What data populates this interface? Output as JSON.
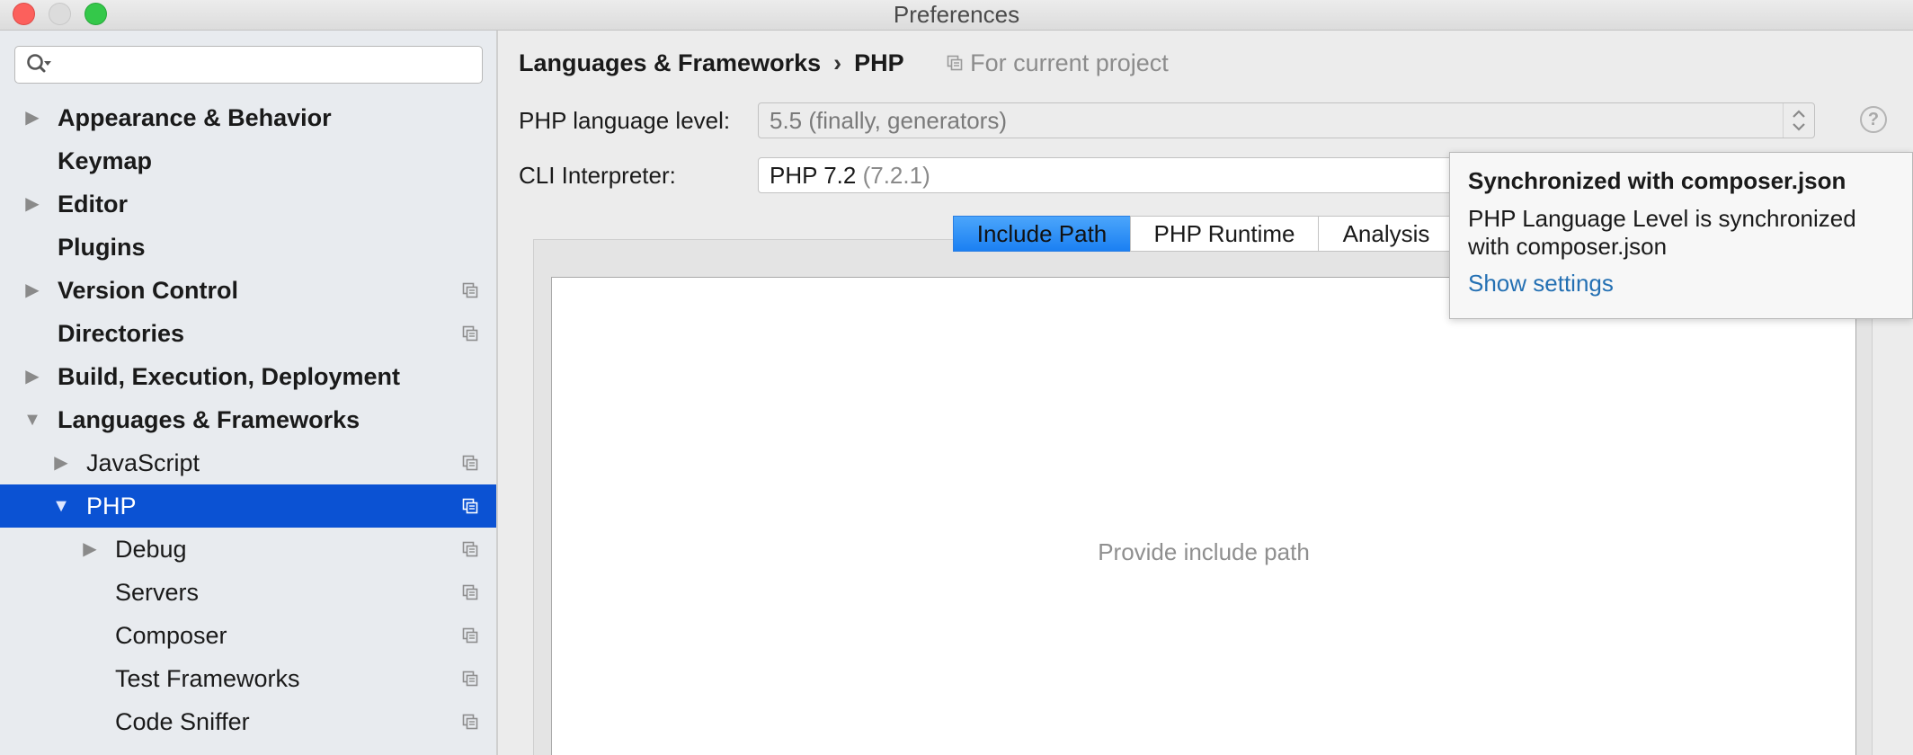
{
  "window": {
    "title": "Preferences"
  },
  "search": {
    "value": "",
    "placeholder": ""
  },
  "sidebar": {
    "items": [
      {
        "label": "Appearance & Behavior",
        "bold": true,
        "arrow": "right",
        "level": 0,
        "project_icon": false
      },
      {
        "label": "Keymap",
        "bold": true,
        "arrow": "none",
        "level": 0,
        "project_icon": false
      },
      {
        "label": "Editor",
        "bold": true,
        "arrow": "right",
        "level": 0,
        "project_icon": false
      },
      {
        "label": "Plugins",
        "bold": true,
        "arrow": "none",
        "level": 0,
        "project_icon": false
      },
      {
        "label": "Version Control",
        "bold": true,
        "arrow": "right",
        "level": 0,
        "project_icon": true
      },
      {
        "label": "Directories",
        "bold": true,
        "arrow": "none",
        "level": 0,
        "project_icon": true
      },
      {
        "label": "Build, Execution, Deployment",
        "bold": true,
        "arrow": "right",
        "level": 0,
        "project_icon": false
      },
      {
        "label": "Languages & Frameworks",
        "bold": true,
        "arrow": "down",
        "level": 0,
        "project_icon": false
      },
      {
        "label": "JavaScript",
        "bold": false,
        "arrow": "right",
        "level": 1,
        "project_icon": true
      },
      {
        "label": "PHP",
        "bold": false,
        "arrow": "down",
        "level": 1,
        "project_icon": true,
        "selected": true
      },
      {
        "label": "Debug",
        "bold": false,
        "arrow": "right",
        "level": 2,
        "project_icon": true
      },
      {
        "label": "Servers",
        "bold": false,
        "arrow": "none",
        "level": 2,
        "project_icon": true
      },
      {
        "label": "Composer",
        "bold": false,
        "arrow": "none",
        "level": 2,
        "project_icon": true
      },
      {
        "label": "Test Frameworks",
        "bold": false,
        "arrow": "none",
        "level": 2,
        "project_icon": true
      },
      {
        "label": "Code Sniffer",
        "bold": false,
        "arrow": "none",
        "level": 2,
        "project_icon": true
      }
    ]
  },
  "breadcrumb": {
    "parent": "Languages & Frameworks",
    "separator": "›",
    "current": "PHP",
    "scope_note": "For current project"
  },
  "form": {
    "language_level_label": "PHP language level:",
    "language_level_value": "5.5 (finally, generators)",
    "cli_label": "CLI Interpreter:",
    "cli_name": "PHP 7.2",
    "cli_version": "(7.2.1)",
    "help_glyph": "?"
  },
  "tabs": [
    {
      "label": "Include Path",
      "active": true
    },
    {
      "label": "PHP Runtime",
      "active": false
    },
    {
      "label": "Analysis",
      "active": false
    }
  ],
  "include_path": {
    "empty_text": "Provide include path"
  },
  "popup": {
    "title": "Synchronized with composer.json",
    "body": "PHP Language Level is synchronized with composer.json",
    "link": "Show settings"
  },
  "colors": {
    "selection": "#0b52d3",
    "tab_active": "#1b80f2",
    "link": "#2470b3"
  },
  "icons": {
    "search": "magnifier-with-dropdown",
    "project_scope": "copy-pages",
    "help": "question-circle"
  }
}
